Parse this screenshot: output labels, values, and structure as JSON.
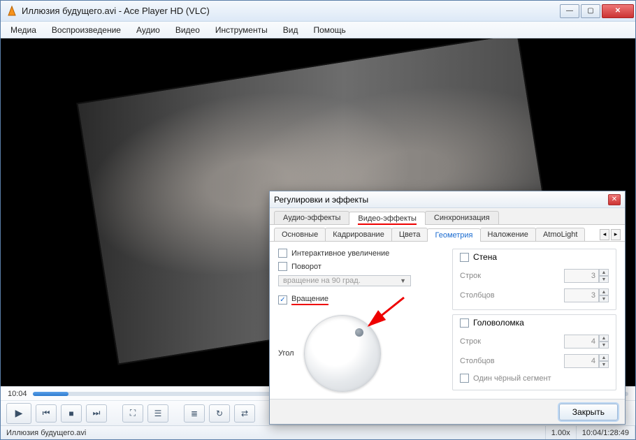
{
  "window": {
    "title": "Иллюзия будущего.avi - Ace Player HD (VLC)"
  },
  "menu": {
    "items": [
      "Медиа",
      "Воспроизведение",
      "Аудио",
      "Видео",
      "Инструменты",
      "Вид",
      "Помощь"
    ]
  },
  "seek": {
    "current": "10:04"
  },
  "status": {
    "file": "Иллюзия будущего.avi",
    "speed": "1.00x",
    "time": "10:04/1:28:49"
  },
  "dialog": {
    "title": "Регулировки и эффекты",
    "tabs": {
      "audio": "Аудио-эффекты",
      "video": "Видео-эффекты",
      "sync": "Синхронизация"
    },
    "subtabs": {
      "basic": "Основные",
      "crop": "Кадрирование",
      "colors": "Цвета",
      "geometry": "Геометрия",
      "overlay": "Наложение",
      "atmo": "AtmoLight"
    },
    "geom": {
      "zoom_chk": "Интерактивное увеличение",
      "rotate_chk": "Поворот",
      "rotate_combo": "вращение на 90 град.",
      "spin_chk": "Вращение",
      "angle_label": "Угол"
    },
    "wall": {
      "title": "Стена",
      "rows_label": "Строк",
      "rows_val": "3",
      "cols_label": "Столбцов",
      "cols_val": "3"
    },
    "puzzle": {
      "title": "Головоломка",
      "rows_label": "Строк",
      "rows_val": "4",
      "cols_label": "Столбцов",
      "cols_val": "4",
      "black_chk": "Один чёрный сегмент"
    },
    "close": "Закрыть"
  }
}
